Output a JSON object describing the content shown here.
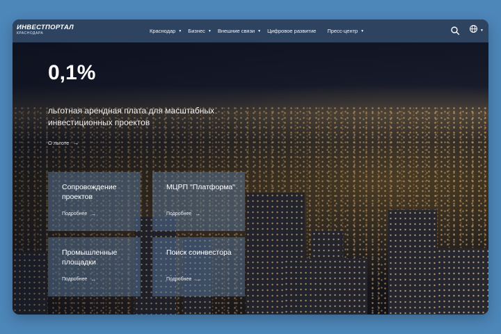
{
  "header": {
    "logo_main": "ИНВЕСТПОРТАЛ",
    "logo_sub": "КРАСНОДАРА",
    "nav": [
      {
        "label": "Краснодар",
        "caret": "▼"
      },
      {
        "label": "Бизнес",
        "caret": "▼"
      },
      {
        "label": "Внешние связи",
        "caret": "▼"
      },
      {
        "label": "Цифровое развитие",
        "caret": ""
      },
      {
        "label": "Пресс-центр",
        "caret": "▼"
      }
    ],
    "search_icon": "search-icon",
    "language_icon": "globe-icon",
    "language_caret": "▼"
  },
  "hero": {
    "highlight": "0,1%",
    "subtitle": "льготная арендная плата для масштабных инвестиционных проектов",
    "link_label": "О льготе",
    "link_arrow": "→"
  },
  "cards": [
    {
      "title": "Сопровождение проектов",
      "link": "Подробнее",
      "arrow": "→"
    },
    {
      "title": "МЦРП \"Платформа\"",
      "link": "Подробнее",
      "arrow": "→"
    },
    {
      "title": "Промышленные площадки",
      "link": "Подробнее",
      "arrow": "→"
    },
    {
      "title": "Поиск соинвестора",
      "link": "Подробнее",
      "arrow": "→"
    }
  ],
  "colors": {
    "page_background": "#4d86b9",
    "header_background": "#2d4360",
    "card_background": "#5f82aa"
  }
}
